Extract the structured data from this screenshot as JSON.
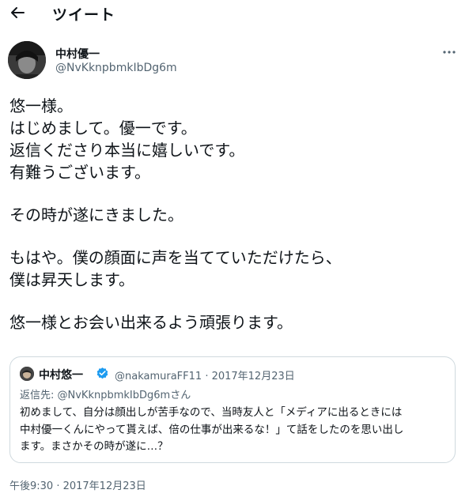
{
  "header": {
    "back_icon": "arrow-left-icon",
    "title": "ツイート"
  },
  "tweet": {
    "author_name": "中村優一",
    "author_handle": "@NvKknpbmkIbDg6m",
    "more_icon": "more-horizontal-icon",
    "lines": [
      "悠一様。",
      "はじめまして。優一です。",
      "返信くださり本当に嬉しいです。",
      "有難うございます。",
      "",
      "その時が遂にきました。",
      "",
      "もはや。僕の顔面に声を当てていただけたら、",
      "僕は昇天します。",
      "",
      "悠一様とお会い出来るよう頑張ります。"
    ],
    "timestamp": "午後9:30 · 2017年12月23日"
  },
  "quote": {
    "author_name": "中村悠一",
    "verified_icon": "verified-badge-icon",
    "handle_date": "@nakamuraFF11 · 2017年12月23日",
    "reply_prefix": "返信先: ",
    "reply_handle": "@NvKknpbmkIbDg6mさん",
    "body_lines": [
      "初めまして、自分は顔出しが苦手なので、当時友人と「メディアに出るときには",
      "中村優一くんにやって貰えば、倍の仕事が出来るな！」て話をしたのを思い出し",
      "ます。まさかその時が遂に…？"
    ]
  },
  "colors": {
    "text": "#0f1419",
    "secondary": "#536471",
    "border": "#cfd9de",
    "verified": "#1d9bf0"
  }
}
